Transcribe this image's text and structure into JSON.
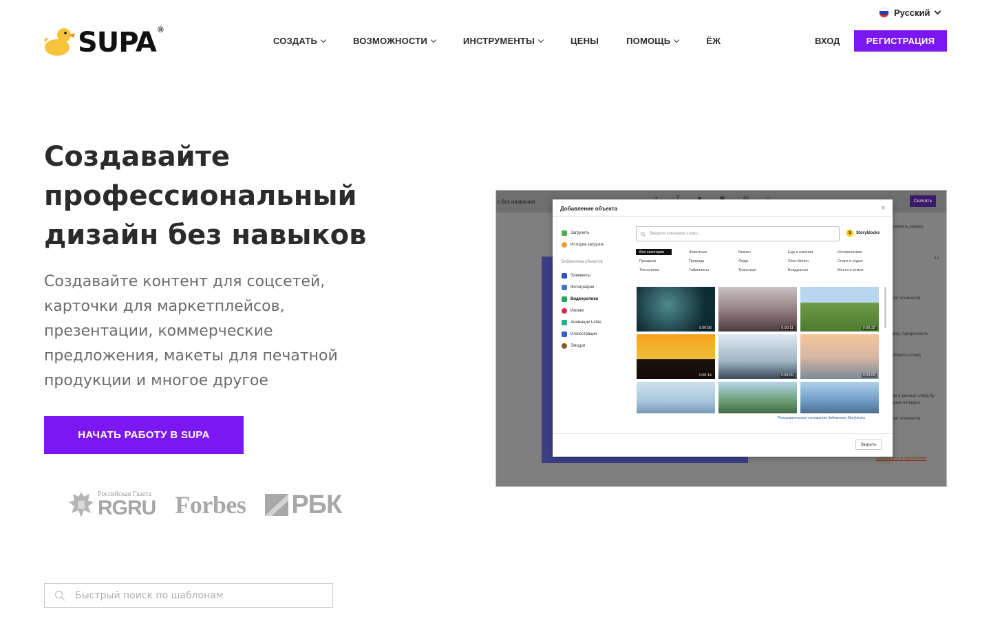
{
  "language": {
    "label": "Русский"
  },
  "header": {
    "logo_text": "SUPA",
    "logo_mark": "®",
    "nav": [
      {
        "label": "СОЗДАТЬ",
        "dropdown": true
      },
      {
        "label": "ВОЗМОЖНОСТИ",
        "dropdown": true
      },
      {
        "label": "ИНСТРУМЕНТЫ",
        "dropdown": true
      },
      {
        "label": "ЦЕНЫ",
        "dropdown": false
      },
      {
        "label": "ПОМОЩЬ",
        "dropdown": true
      },
      {
        "label": "ЁЖ",
        "dropdown": false
      }
    ],
    "login": "ВХОД",
    "register": "РЕГИСТРАЦИЯ"
  },
  "hero": {
    "title": "Создавайте профессиональный дизайн без навыков",
    "subtitle": "Создавайте контент для соцсетей, карточки для маркетплейсов, презентации, коммерческие предложения, макеты для печатной продукции и многое другое",
    "cta": "НАЧАТЬ РАБОТУ В SUPA"
  },
  "press": {
    "rgru_small": "Российская Газета",
    "rgru_big": "RGRU",
    "forbes": "Forbes",
    "rbk": "РБК"
  },
  "template_search": {
    "placeholder": "Быстрый поиск по шаблонам"
  },
  "preview": {
    "doc_title": "с без названия",
    "download": "Скачать",
    "right_panel": [
      "зменить размер",
      "0.0",
      "чет элементов",
      "вод. Прозрачность",
      "обавить слайд",
      "ии в данный слайд бу",
      "ржке ни видео.",
      "чет элементов"
    ],
    "report": "Сообщить о проблеме",
    "modal": {
      "title": "Добавление объекта",
      "close": "×",
      "upload": "Загрузить",
      "history": "История загрузок",
      "library_label": "Библиотека объектов",
      "library": [
        "Элементы",
        "Фотографии",
        "Видеоролики",
        "Иконки",
        "Анимации Lottie",
        "Иллюстрации",
        "Эмодзи"
      ],
      "active_library": "Видеоролики",
      "search_placeholder": "Введите ключевое слово...",
      "provider": "Storyblocks",
      "categories": [
        "Все категории",
        "Животные",
        "Бизнес",
        "Еда и напитки",
        "Исторические",
        "Праздник",
        "Природа",
        "Люди",
        "Slow Motion",
        "Спорт и отдых",
        "Технологии",
        "Таймлапсы",
        "Транспорт",
        "Воздушные",
        "Места и земля"
      ],
      "videos": [
        {
          "duration": "0:00:58"
        },
        {
          "duration": "0:00:11"
        },
        {
          "duration": "0:00:32"
        },
        {
          "duration": "0:00:14"
        },
        {
          "duration": "0:00:09"
        },
        {
          "duration": "0:00:09"
        },
        {
          "duration": ""
        },
        {
          "duration": ""
        },
        {
          "duration": ""
        }
      ],
      "credit": "Пользовательское соглашение библиотеки Storyblocks",
      "close_button": "Закрыть"
    }
  },
  "colors": {
    "accent": "#7b17f2",
    "text": "#2b2b2b",
    "muted": "#6b6b6b"
  }
}
